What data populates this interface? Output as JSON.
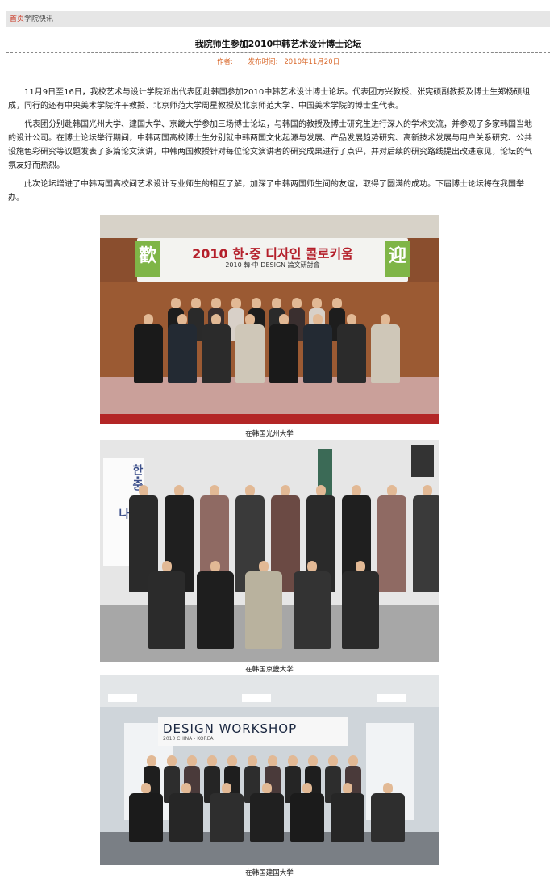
{
  "breadcrumb": {
    "home": "首页",
    "separator": "",
    "current": "学院快讯"
  },
  "article": {
    "title": "我院师生参加2010中韩艺术设计博士论坛",
    "author_label": "作者:",
    "author": "",
    "date_label": "发布时间:",
    "date": "2010年11月20日",
    "paragraphs": [
      "11月9日至16日，我校艺术与设计学院派出代表团赴韩国参加2010中韩艺术设计博士论坛。代表团方兴教授、张宪硕副教授及博士生郑杨硕组成，同行的还有中央美术学院许平教授、北京师范大学周星教授及北京师范大学、中国美术学院的博士生代表。",
      "代表团分别赴韩国光州大学、建国大学、京畿大学参加三场博士论坛，与韩国的教授及博士研究生进行深入的学术交流，并参观了多家韩国当地的设计公司。在博士论坛举行期间，中韩两国高校博士生分别就中韩两国文化起源与发展、产品发展趋势研究、高新技术发展与用户关系研究、公共设施色彩研究等议题发表了多篇论文演讲，中韩两国教授针对每位论文演讲者的研究成果进行了点评，并对后续的研究路线提出改进意见，论坛的气氛友好而热烈。",
      "此次论坛增进了中韩两国高校间艺术设计专业师生的相互了解，加深了中韩两国师生间的友谊，取得了圆满的成功。下届博士论坛将在我国举办。"
    ]
  },
  "photos": [
    {
      "caption": "在韩国光州大学",
      "banner_text": "2010 한·중 디자인 콜로키움",
      "banner_sub": "2010 韓·中 DESIGN 論文研討會",
      "banner_left": "歡",
      "banner_right": "迎"
    },
    {
      "caption": "在韩国京畿大学",
      "banner_text": "한·중 영상예술세미나"
    },
    {
      "caption": "在韩国建国大学",
      "banner_text": "DESIGN WORKSHOP",
      "banner_sub": "2010 CHINA - KOREA"
    }
  ],
  "colors": {
    "crumb_home": "#c8331f",
    "meta": "#d9682b",
    "breadcrumb_bg": "#e6e6e6"
  }
}
